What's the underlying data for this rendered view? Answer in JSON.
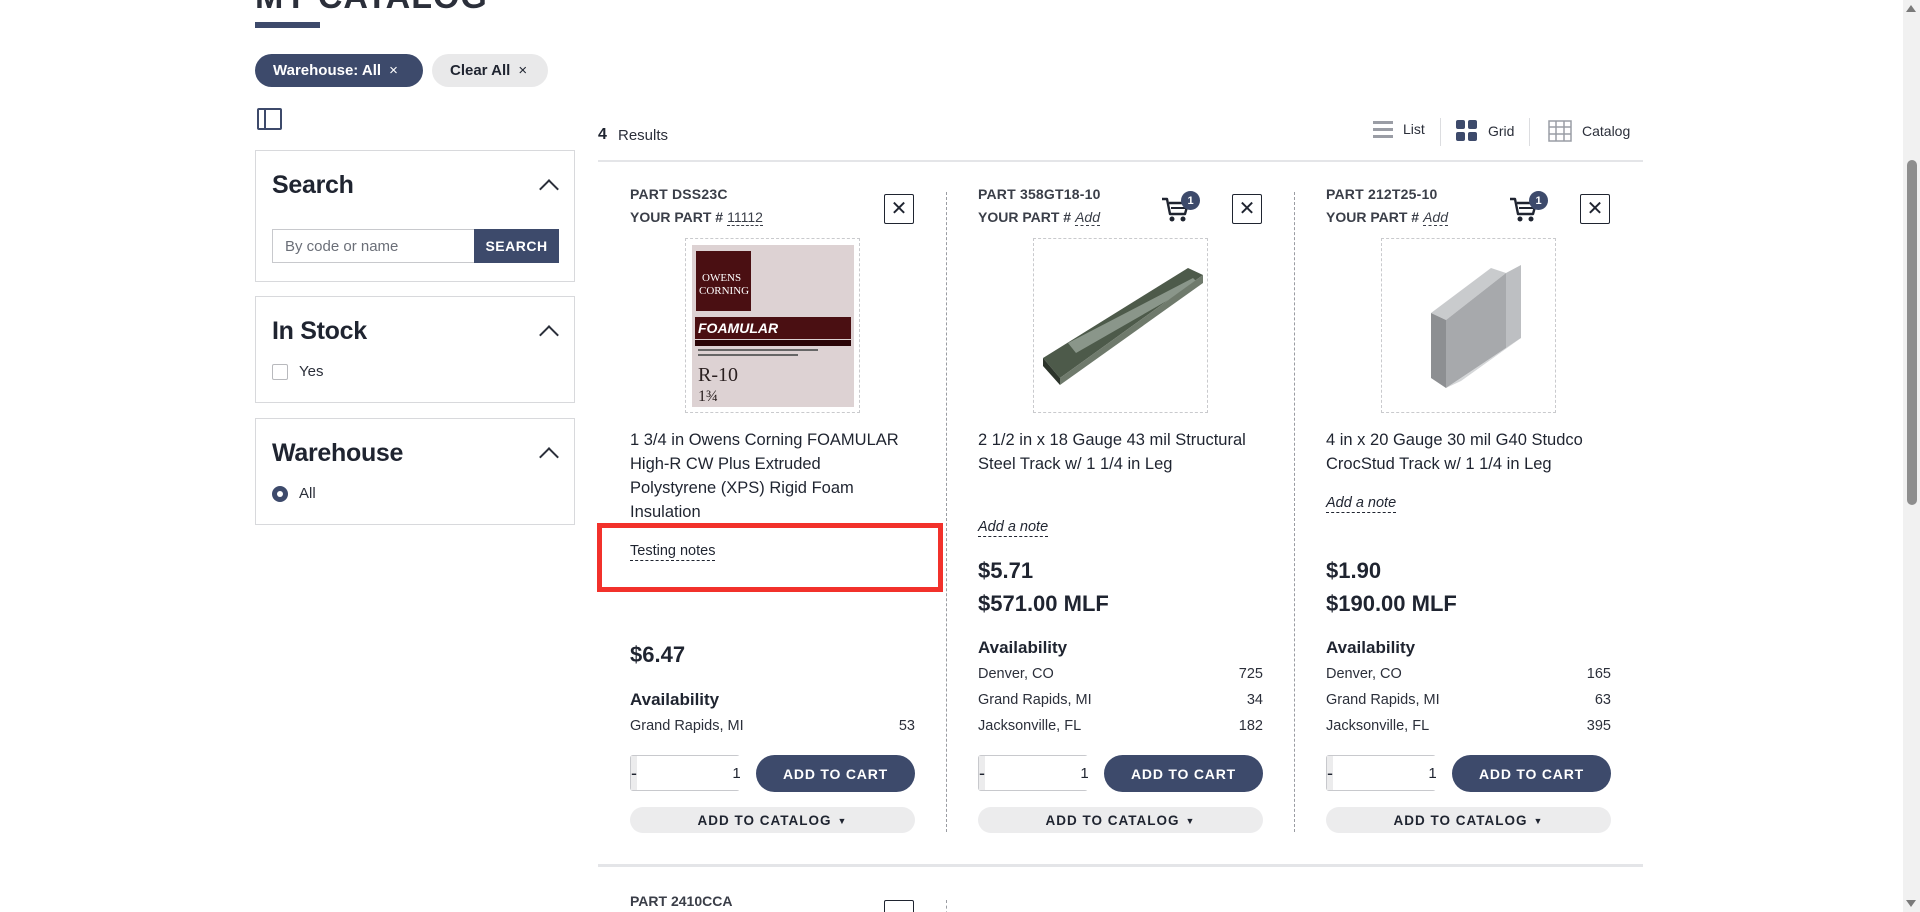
{
  "page": {
    "title": "MY CATALOG"
  },
  "filters": {
    "chips": [
      {
        "label": "Warehouse: All",
        "close": "×"
      },
      {
        "label": "Clear All",
        "close": "×"
      }
    ]
  },
  "sidebar": {
    "search": {
      "title": "Search",
      "placeholder": "By code or name",
      "button": "SEARCH"
    },
    "in_stock": {
      "title": "In Stock",
      "option": "Yes",
      "checked": false
    },
    "warehouse": {
      "title": "Warehouse",
      "option": "All",
      "selected": true
    }
  },
  "results": {
    "count": "4",
    "label": "Results",
    "views": [
      {
        "label": "List",
        "icon": "list-icon"
      },
      {
        "label": "Grid",
        "icon": "grid-icon"
      },
      {
        "label": "Catalog",
        "icon": "catalog-table-icon"
      }
    ]
  },
  "products": [
    {
      "part": "PART DSS23C",
      "your_part_label": "YOUR PART #",
      "your_part_value": "11112",
      "cart_count": "",
      "image_icon": "owens-corning-foamular-product-image",
      "description": "1 3/4 in Owens Corning FOAMULAR High-R CW Plus Extruded Polystyrene (XPS) Rigid Foam Insulation",
      "note": "Testing notes",
      "price": "$6.47",
      "price_mlf": "",
      "availability_title": "Availability",
      "availability": [
        {
          "location": "Grand Rapids, MI",
          "qty": "53"
        }
      ],
      "qty": "1",
      "add_to_cart": "ADD TO CART",
      "add_to_catalog": "ADD TO CATALOG"
    },
    {
      "part": "PART 358GT18-10",
      "your_part_label": "YOUR PART #",
      "your_part_value": "Add",
      "cart_count": "1",
      "image_icon": "steel-track-product-image",
      "description": "2 1/2 in x 18 Gauge 43 mil Structural Steel Track w/ 1 1/4 in Leg",
      "note": "Add a note",
      "price": "$5.71",
      "price_mlf": "$571.00 MLF",
      "availability_title": "Availability",
      "availability": [
        {
          "location": "Denver, CO",
          "qty": "725"
        },
        {
          "location": "Grand Rapids, MI",
          "qty": "34"
        },
        {
          "location": "Jacksonville, FL",
          "qty": "182"
        }
      ],
      "qty": "1",
      "add_to_cart": "ADD TO CART",
      "add_to_catalog": "ADD TO CATALOG"
    },
    {
      "part": "PART 212T25-10",
      "your_part_label": "YOUR PART #",
      "your_part_value": "Add",
      "cart_count": "1",
      "image_icon": "crocstud-track-product-image",
      "description": "4 in x 20 Gauge 30 mil G40 Studco CrocStud Track w/ 1 1/4 in Leg",
      "note": "Add a note",
      "price": "$1.90",
      "price_mlf": "$190.00 MLF",
      "availability_title": "Availability",
      "availability": [
        {
          "location": "Denver, CO",
          "qty": "165"
        },
        {
          "location": "Grand Rapids, MI",
          "qty": "63"
        },
        {
          "location": "Jacksonville, FL",
          "qty": "395"
        }
      ],
      "qty": "1",
      "add_to_cart": "ADD TO CART",
      "add_to_catalog": "ADD TO CATALOG"
    }
  ],
  "next_row": {
    "part": "PART 2410CCA"
  },
  "colors": {
    "primary": "#3d4a6b",
    "highlight": "#f2312b",
    "chip_light": "#e9e9ea"
  }
}
